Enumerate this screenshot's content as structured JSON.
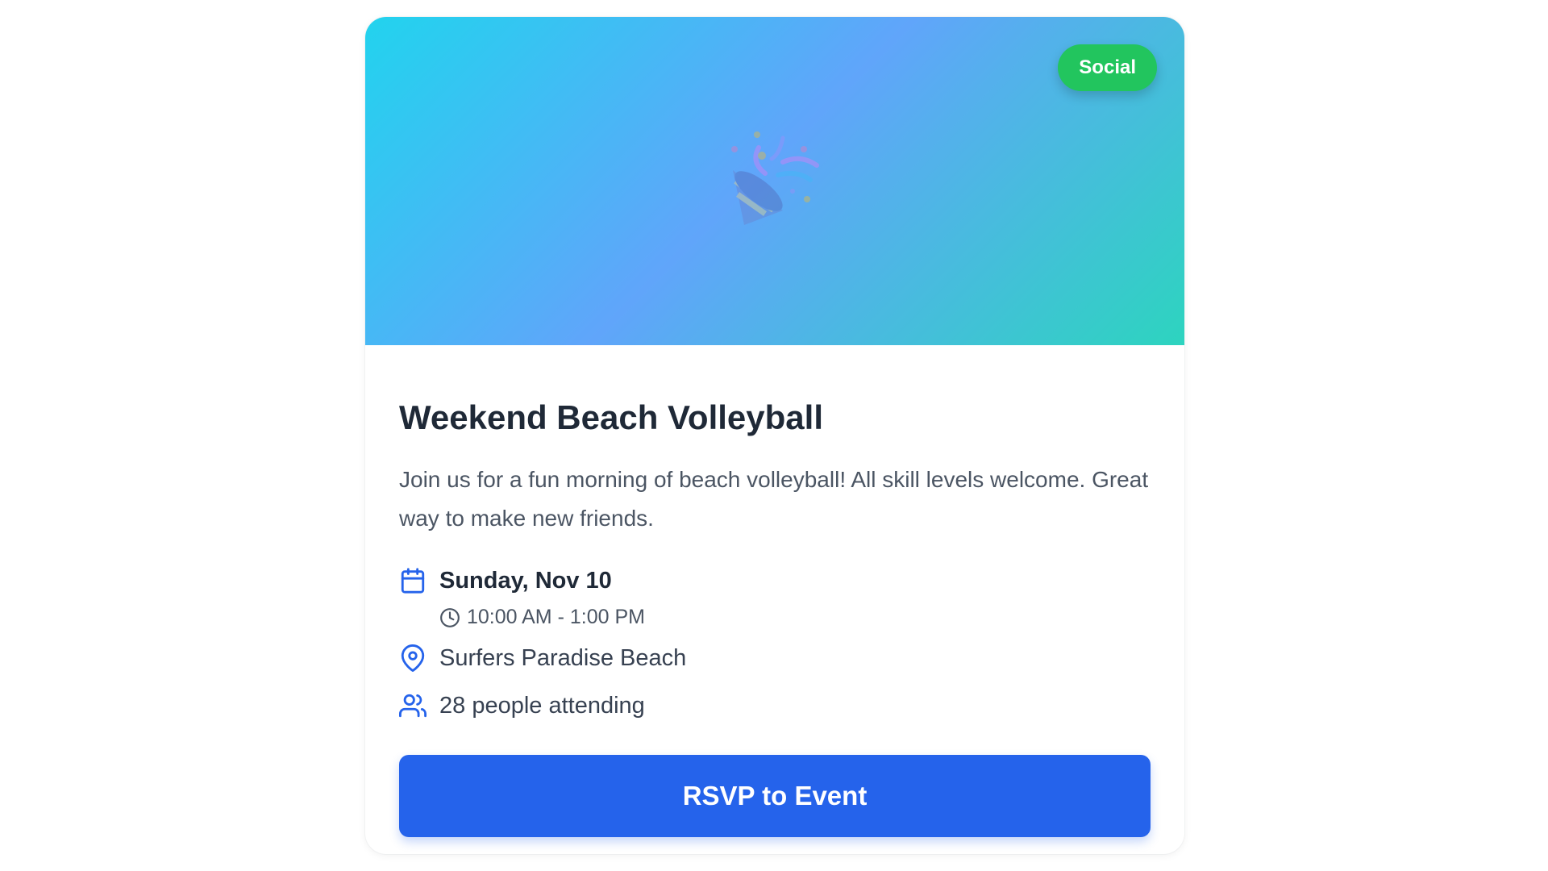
{
  "event": {
    "category_badge": "Social",
    "title": "Weekend Beach Volleyball",
    "description": "Join us for a fun morning of beach volleyball! All skill levels welcome. Great way to make new friends.",
    "date": "Sunday, Nov 10",
    "time": "10:00 AM - 1:00 PM",
    "location": "Surfers Paradise Beach",
    "attendees_text": "28 people attending",
    "rsvp_label": "RSVP to Event"
  },
  "icons": {
    "hero": "party-popper-icon",
    "date": "calendar-icon",
    "time": "clock-icon",
    "location": "map-pin-icon",
    "attendees": "users-icon"
  },
  "colors": {
    "hero_gradient": [
      "#22d3ee",
      "#60a5fa",
      "#2dd4bf"
    ],
    "badge": "#22c55e",
    "accent": "#2563eb",
    "title": "#1f2937",
    "body_text": "#4b5563"
  }
}
